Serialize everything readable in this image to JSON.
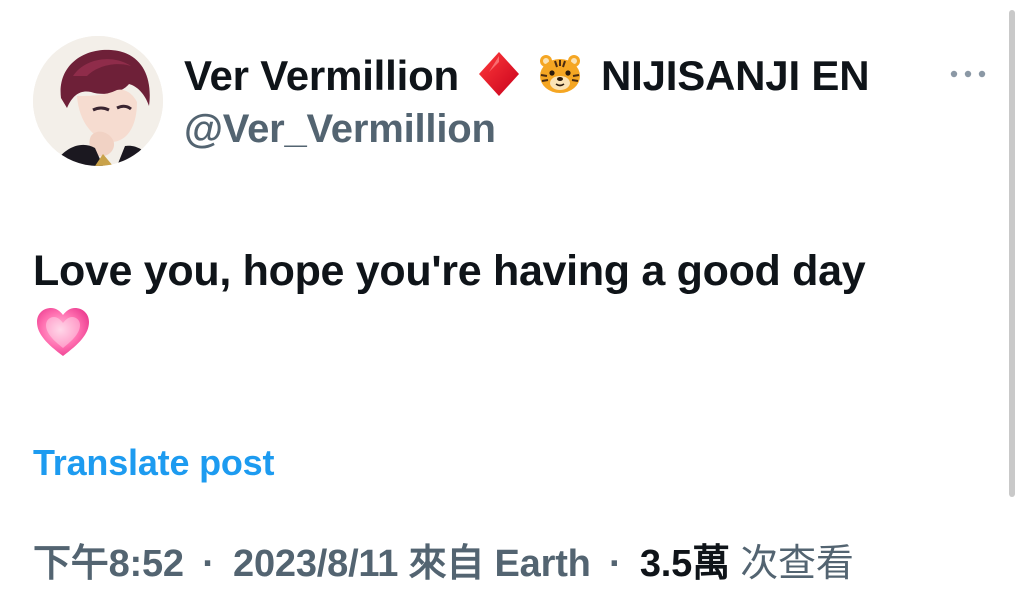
{
  "author": {
    "display_name": "Ver Vermillion",
    "org_name": "NIJISANJI EN",
    "handle": "@Ver_Vermillion",
    "avatar_icon": "profile-avatar",
    "badges": [
      "red-diamond-icon",
      "tiger-face-icon"
    ]
  },
  "actions": {
    "more_icon": "more-options-icon"
  },
  "post": {
    "text": "Love you, hope you're having a good day",
    "trailing_emoji": "pink-heart-icon"
  },
  "translate": {
    "label": "Translate post"
  },
  "meta": {
    "time": "下午8:52",
    "date": "2023/8/11",
    "source": "來自 Earth",
    "separator": "·",
    "views_count": "3.5萬",
    "views_label": "次查看"
  },
  "colors": {
    "text_primary": "#0f1419",
    "text_secondary": "#536471",
    "link_blue": "#1d9bf0",
    "background": "#ffffff"
  }
}
